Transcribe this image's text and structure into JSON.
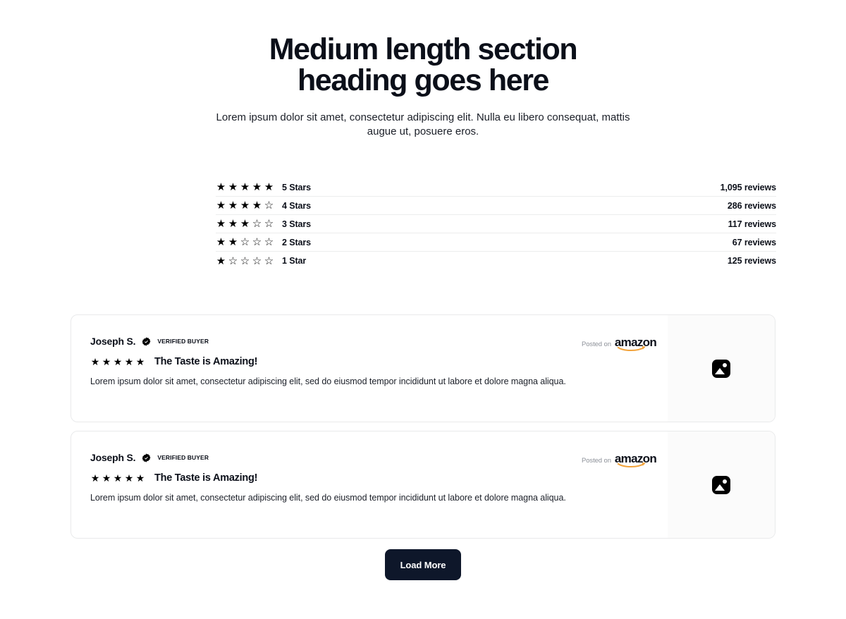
{
  "header": {
    "heading_line1": "Medium length section",
    "heading_line2": "heading goes here",
    "subheading": "Lorem ipsum dolor sit amet, consectetur adipiscing elit. Nulla eu libero consequat, mattis augue ut, posuere eros."
  },
  "ratings": {
    "rows": [
      {
        "label": "5 Stars",
        "filled": 5,
        "count": "1,095 reviews"
      },
      {
        "label": "4 Stars",
        "filled": 4,
        "count": "286 reviews"
      },
      {
        "label": "3 Stars",
        "filled": 3,
        "count": "117 reviews"
      },
      {
        "label": "2 Stars",
        "filled": 2,
        "count": "67 reviews"
      },
      {
        "label": "1 Star",
        "filled": 1,
        "count": "125 reviews"
      }
    ]
  },
  "reviews": {
    "items": [
      {
        "name": "Joseph S.",
        "verified_label": "VERIFIED BUYER",
        "stars": 5,
        "title": "The Taste is Amazing!",
        "text": "Lorem ipsum dolor sit amet, consectetur adipiscing elit, sed do eiusmod tempor incididunt ut labore et dolore magna aliqua.",
        "posted_on_label": "Posted on",
        "source": "amazon",
        "media_icon": "image-placeholder-icon"
      },
      {
        "name": "Joseph S.",
        "verified_label": "VERIFIED BUYER",
        "stars": 5,
        "title": "The Taste is Amazing!",
        "text": "Lorem ipsum dolor sit amet, consectetur adipiscing elit, sed do eiusmod tempor incididunt ut labore et dolore magna aliqua.",
        "posted_on_label": "Posted on",
        "source": "amazon",
        "media_icon": "image-placeholder-icon"
      }
    ]
  },
  "footer": {
    "load_more_label": "Load More"
  },
  "colors": {
    "text": "#0b0f19",
    "muted": "#8d9199",
    "border": "#e9eaeb",
    "divider": "#eceded",
    "button_bg": "#0e172a",
    "amazon_orange": "#f2a33c",
    "media_panel": "#fbfbfb"
  },
  "icons": {
    "star_filled": "★",
    "star_empty": "☆",
    "verified": "verified-badge-icon"
  }
}
